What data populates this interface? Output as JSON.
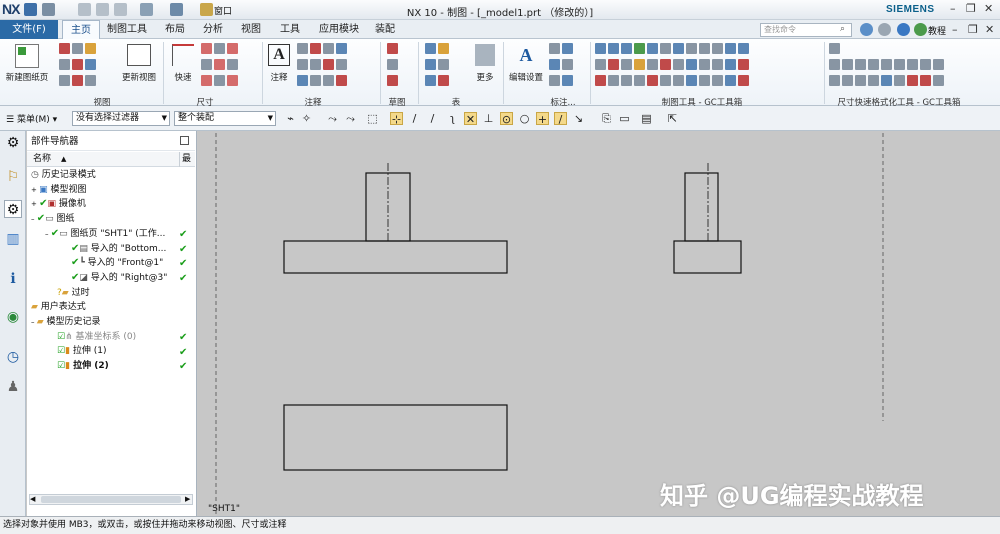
{
  "app": {
    "logo": "NX",
    "title": "NX 10 - 制图 - [_model1.prt （修改的）]",
    "brand": "SIEMENS",
    "window_menu": "窗口"
  },
  "menu": {
    "file": "文件(F)",
    "tabs": [
      "主页",
      "制图工具",
      "布局",
      "分析",
      "视图",
      "工具",
      "应用模块",
      "装配"
    ],
    "active": "主页"
  },
  "search": {
    "placeholder": "查找命令"
  },
  "tutorial": "教程",
  "ribbon": {
    "new_sheet": "新建图纸页",
    "update_view": "更新视图",
    "quick": "快速",
    "note": "注释",
    "more": "更多",
    "edit_settings": "编辑设置",
    "groups": [
      "视图",
      "尺寸",
      "注释",
      "草图",
      "表",
      "标注...",
      "制图工具 - GC工具箱",
      "尺寸快速格式化工具 - GC工具箱"
    ]
  },
  "filterbar": {
    "menu": "菜单(M)",
    "filter": "没有选择过滤器",
    "scope": "整个装配"
  },
  "navigator": {
    "title": "部件导航器",
    "col_name": "名称",
    "col_latest": "最",
    "rows": [
      {
        "label": "历史记录模式",
        "indent": 0
      },
      {
        "label": "模型视图",
        "indent": 0
      },
      {
        "label": "摄像机",
        "indent": 0
      },
      {
        "label": "图纸",
        "indent": 0
      },
      {
        "label": "图纸页 \"SHT1\" (工作...",
        "indent": 1
      },
      {
        "label": "导入的 \"Bottom...",
        "indent": 2
      },
      {
        "label": "导入的 \"Front@1\"",
        "indent": 2
      },
      {
        "label": "导入的 \"Right@3\"",
        "indent": 2
      },
      {
        "label": "过时",
        "indent": 1
      },
      {
        "label": "用户表达式",
        "indent": 0
      },
      {
        "label": "模型历史记录",
        "indent": 0
      },
      {
        "label": "基准坐标系 (0)",
        "indent": 1
      },
      {
        "label": "拉伸 (1)",
        "indent": 1
      },
      {
        "label": "拉伸 (2)",
        "indent": 1
      }
    ]
  },
  "sheet": {
    "label": "\"SHT1\""
  },
  "status": "选择对象并使用 MB3，或双击，或按住并拖动来移动视图、尺寸或注释",
  "watermark": "知乎 @UG编程实战教程",
  "colors": {
    "accent": "#2b6aa6",
    "check": "#1b9e1b"
  }
}
